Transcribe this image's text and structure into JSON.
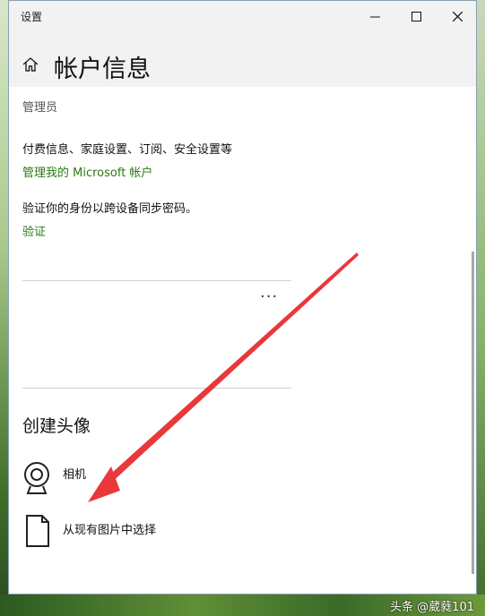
{
  "window": {
    "title": "设置",
    "minimize_icon": "minimize-icon",
    "maximize_icon": "maximize-icon",
    "close_icon": "close-icon"
  },
  "header": {
    "home_icon": "home-icon",
    "page_title": "帐户信息"
  },
  "account": {
    "role": "管理员",
    "billing_text": "付费信息、家庭设置、订阅、安全设置等",
    "manage_link": "管理我的 Microsoft 帐户",
    "verify_text": "验证你的身份以跨设备同步密码。",
    "verify_link": "验证",
    "more_label": "···"
  },
  "avatar": {
    "section_title": "创建头像",
    "camera_label": "相机",
    "camera_icon": "camera-icon",
    "browse_label": "从现有图片中选择",
    "browse_icon": "file-icon"
  },
  "watermark": "头条 @葳蕤101",
  "colors": {
    "link": "#2c7a12",
    "annotation_arrow": "#e8383b"
  }
}
